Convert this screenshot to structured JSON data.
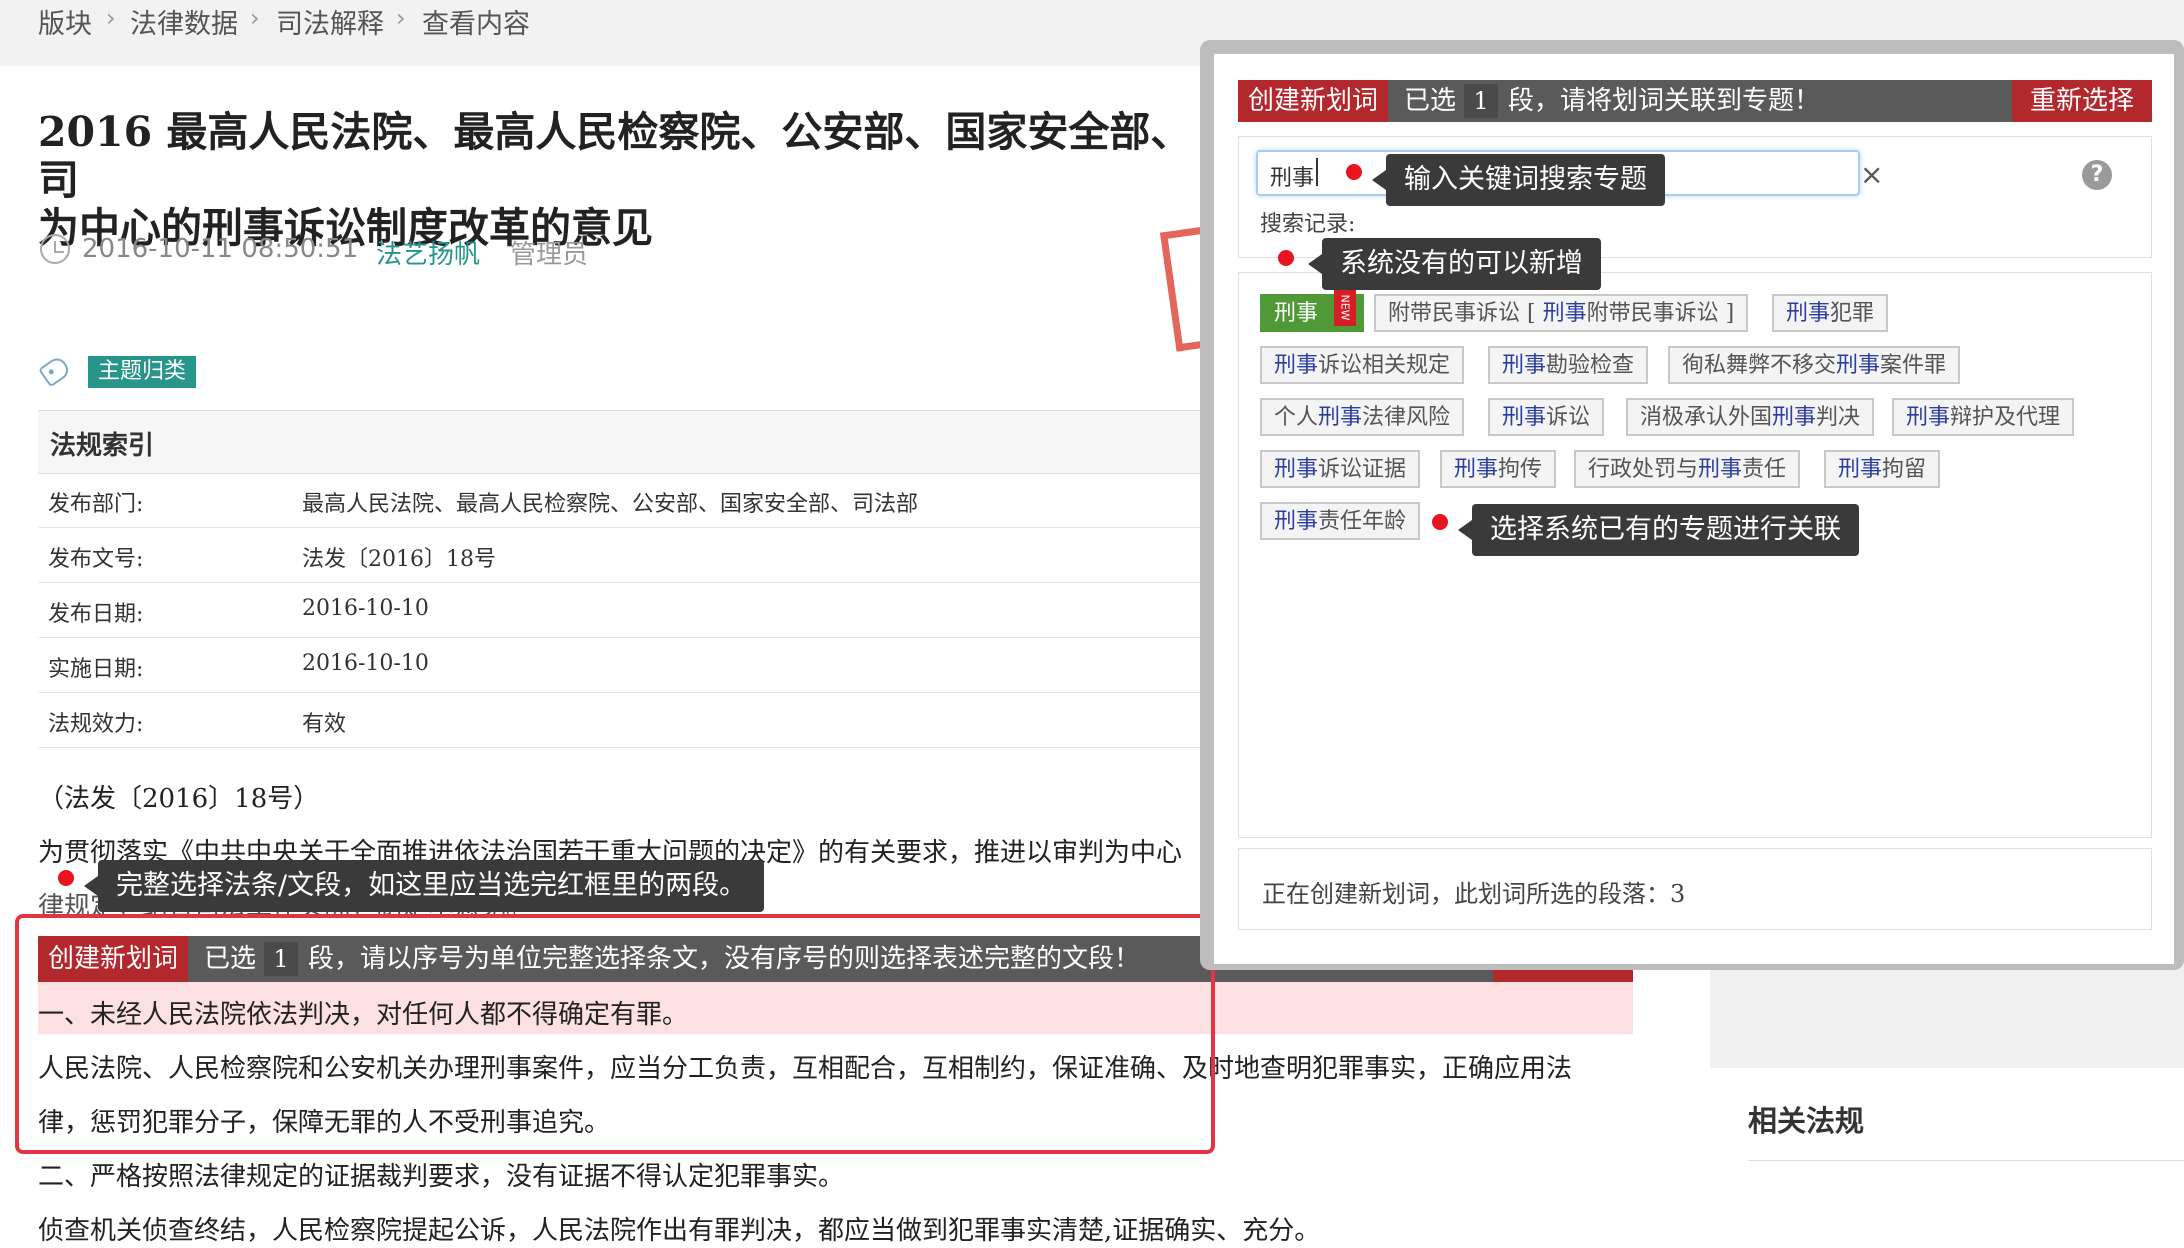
{
  "breadcrumb": {
    "items": [
      "版块",
      "法律数据",
      "司法解释",
      "查看内容"
    ],
    "separator": "›"
  },
  "article": {
    "title": "2016 最高人民法院、最高人民检察院、公安部、国家安全部、司\n为中心的刑事诉讼制度改革的意见",
    "datetime": "2016-10-11 08:50:51",
    "author": "法艺扬帆",
    "role": "管理员",
    "topic_badge": "主题归类"
  },
  "regulation_index": {
    "heading": "法规索引",
    "rows": [
      {
        "key": "发布部门:",
        "value": "最高人民法院、最高人民检察院、公安部、国家安全部、司法部"
      },
      {
        "key": "发布文号:",
        "value": "法发〔2016〕18号"
      },
      {
        "key": "发布日期:",
        "value": "2016-10-10"
      },
      {
        "key": "实施日期:",
        "value": "2016-10-10"
      },
      {
        "key": "法规效力:",
        "value": "有效"
      }
    ]
  },
  "body": {
    "doc_no": "（法发〔2016〕18号）",
    "intro_line1": "为贯彻落实《中共中央关于全面推进依法治国若干重大问题的决定》的有关要求，推进以审判为中心",
    "intro_line2": "律规定，结合司法工作实际，制定本意见。",
    "clause1": "一、未经人民法院依法判决，对任何人都不得确定有罪。",
    "clause1_text_a": "人民法院、人民检察院和公安机关办理刑事案件，应当分工负责，互相配合，互相制约，保证准确、及时地查明犯罪事实，正确应用法",
    "clause1_text_b": "律，惩罚犯罪分子，保障无罪的人不受刑事追究。",
    "clause2": "二、严格按照法律规定的证据裁判要求，没有证据不得认定犯罪事实。",
    "clause2_text": "侦查机关侦查终结，人民检察院提起公诉，人民法院作出有罪判决，都应当做到犯罪事实清楚,证据确实、充分。"
  },
  "inline_selection_bar": {
    "create_label": "创建新划词",
    "selected_prefix": "已选",
    "count": "1",
    "instruction": "段，请以序号为单位完整选择条文，没有序号的则选择表述完整的文段！",
    "reselect": "重新选择"
  },
  "tooltips": {
    "select_full": "完整选择法条/文段，如这里应当选完红框里的两段。",
    "search_topic": "输入关键词搜索专题",
    "add_new": "系统没有的可以新增",
    "link_existing": "选择系统已有的专题进行关联"
  },
  "popup": {
    "create_label": "创建新划词",
    "selected_prefix": "已选",
    "count": "1",
    "instruction": "段，请将划词关联到专题！",
    "reselect": "重新选择",
    "search_value": "刑事",
    "clear_icon": "×",
    "help_icon": "?",
    "history_label": "搜索记录:",
    "new_ribbon": "NEW",
    "topics": [
      {
        "pre": "",
        "kw": "刑事",
        "post": "",
        "is_new": true
      },
      {
        "pre": "附带民事诉讼 [ ",
        "kw": "刑事",
        "post": "附带民事诉讼 ]",
        "is_new": false
      },
      {
        "pre": "",
        "kw": "刑事",
        "post": "犯罪",
        "is_new": false
      },
      {
        "pre": "",
        "kw": "刑事",
        "post": "诉讼相关规定",
        "is_new": false
      },
      {
        "pre": "",
        "kw": "刑事",
        "post": "勘验检查",
        "is_new": false
      },
      {
        "pre": "徇私舞弊不移交",
        "kw": "刑事",
        "post": "案件罪",
        "is_new": false
      },
      {
        "pre": "个人",
        "kw": "刑事",
        "post": "法律风险",
        "is_new": false
      },
      {
        "pre": "",
        "kw": "刑事",
        "post": "诉讼",
        "is_new": false
      },
      {
        "pre": "消极承认外国",
        "kw": "刑事",
        "post": "判决",
        "is_new": false
      },
      {
        "pre": "",
        "kw": "刑事",
        "post": "辩护及代理",
        "is_new": false
      },
      {
        "pre": "",
        "kw": "刑事",
        "post": "诉讼证据",
        "is_new": false
      },
      {
        "pre": "",
        "kw": "刑事",
        "post": "拘传",
        "is_new": false
      },
      {
        "pre": "行政处罚与",
        "kw": "刑事",
        "post": "责任",
        "is_new": false
      },
      {
        "pre": "",
        "kw": "刑事",
        "post": "拘留",
        "is_new": false
      },
      {
        "pre": "",
        "kw": "刑事",
        "post": "责任年龄",
        "is_new": false
      }
    ],
    "footer_text": "正在创建新划词，此划词所选的段落：3"
  },
  "sidebar": {
    "related_title": "相关法规"
  },
  "colors": {
    "accent_red": "#b3282d",
    "teal": "#27958c",
    "new_green": "#4f9a36",
    "keyword_blue": "#2c3e9e",
    "highlight_pink": "#fde0e2",
    "frame_red": "#e23442"
  }
}
